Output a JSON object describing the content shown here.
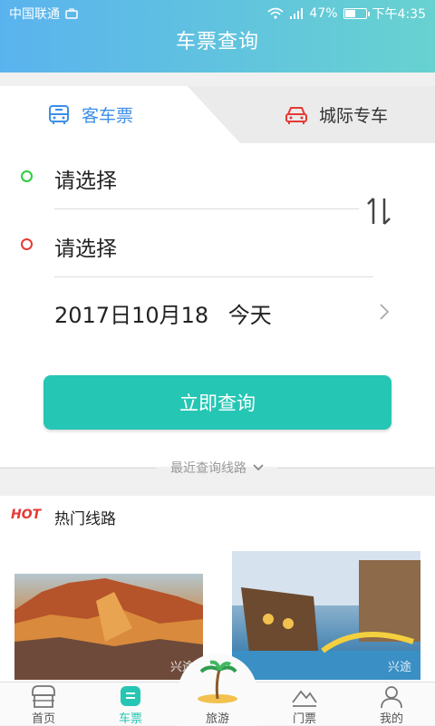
{
  "status": {
    "carrier": "中国联通",
    "battery": "47%",
    "battery_level": 0.47,
    "time": "下午4:35"
  },
  "header": {
    "title": "车票查询"
  },
  "tabs": [
    {
      "label": "客车票",
      "active": true
    },
    {
      "label": "城际专车",
      "active": false
    }
  ],
  "form": {
    "from_placeholder": "请选择",
    "to_placeholder": "请选择",
    "date": "2017日10月18",
    "date_hint": "今天",
    "search_button": "立即查询",
    "recent_label": "最近查询线路"
  },
  "hot": {
    "badge": "HOT",
    "title": "热门线路",
    "items": [
      {
        "caption": "兴途"
      },
      {
        "caption": "兴途"
      }
    ]
  },
  "nav": [
    {
      "label": "首页",
      "icon": "home-icon"
    },
    {
      "label": "车票",
      "icon": "ticket-icon",
      "active": true
    },
    {
      "label": "旅游",
      "icon": "beach-icon"
    },
    {
      "label": "门票",
      "icon": "mountain-icon"
    },
    {
      "label": "我的",
      "icon": "user-icon"
    }
  ],
  "colors": {
    "accent": "#26c6b4",
    "tab_active": "#3d8ee8",
    "from_dot": "#2ecc40",
    "to_dot": "#e53935",
    "hot": "#e53935"
  }
}
